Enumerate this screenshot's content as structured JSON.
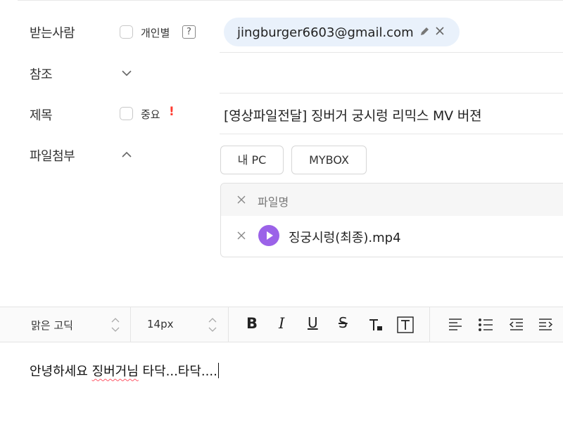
{
  "recipient": {
    "label": "받는사람",
    "individual_label": "개인별",
    "help_glyph": "?",
    "email": "jingburger6603@gmail.com"
  },
  "cc": {
    "label": "참조"
  },
  "subject": {
    "label": "제목",
    "important_label": "중요",
    "important_mark": "!",
    "value": "[영상파일전달] 징버거 궁시렁 리믹스 MV 버젼"
  },
  "attachment": {
    "label": "파일첨부",
    "my_pc_button": "내 PC",
    "mybox_button": "MYBOX",
    "column_header": "파일명",
    "files": [
      {
        "name": "징궁시렁(최종).mp4",
        "type_icon": "play-icon",
        "icon_color": "#9b62e8"
      }
    ]
  },
  "toolbar": {
    "font_family": "맑은 고딕",
    "font_size": "14px",
    "bold": "B",
    "italic": "I",
    "underline": "U",
    "strike": "S"
  },
  "editor": {
    "text_part1": "안녕하세요 ",
    "text_part2": "징버거님",
    "text_part3": " 타닥...타닥...."
  },
  "colors": {
    "chip_bg": "#e9f1fb",
    "important": "#ff3b30",
    "video_icon": "#9b62e8",
    "spellcheck": "#ff5a6a"
  }
}
